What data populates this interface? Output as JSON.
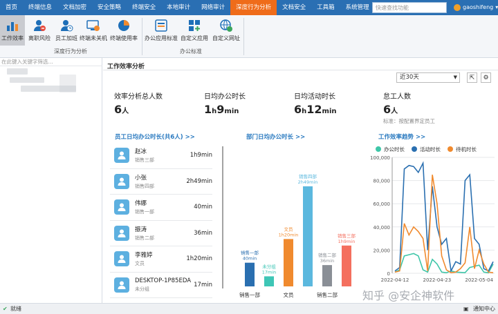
{
  "nav": {
    "tabs": [
      "首页",
      "终端信息",
      "文档加密",
      "安全策略",
      "终端安全",
      "本地审计",
      "网络审计",
      "深度行为分析",
      "文档安全",
      "工具箱",
      "系统管理"
    ],
    "active_index": 7,
    "search_placeholder": "快速查找功能",
    "user": "gaoshifeng"
  },
  "ribbon": {
    "buttons": [
      "工作效率",
      "离职风险",
      "员工加班",
      "终端未关机",
      "终端使用率",
      "办公应用标准",
      "自定义应用",
      "自定义网址"
    ],
    "groups": [
      "深度行为分析",
      "办公标准"
    ]
  },
  "left": {
    "filter_placeholder": "在此键入关键字筛选..."
  },
  "main": {
    "title": "工作效率分析",
    "period": "近30天",
    "stats": [
      {
        "label": "效率分析总人数",
        "value": "6",
        "unit": "人"
      },
      {
        "label": "日均办公时长",
        "value_h": "1",
        "value_m": "9",
        "unit_h": "h",
        "unit_m": "min"
      },
      {
        "label": "日均活动时长",
        "value_h": "6",
        "value_m": "12",
        "unit_h": "h",
        "unit_m": "min"
      },
      {
        "label": "怠工人数",
        "value": "6",
        "unit": "人",
        "note": "标准：按配置界定员工"
      }
    ],
    "sections": [
      "员工日均办公时长(共6人) >>",
      "部门日均办公时长 >>",
      "工作效率趋势 >>"
    ]
  },
  "employees": [
    {
      "name": "赵冰",
      "dept": "销售三部",
      "time": "1h9min"
    },
    {
      "name": "小张",
      "dept": "销售四部",
      "time": "2h49min"
    },
    {
      "name": "伟娜",
      "dept": "销售一部",
      "time": "40min"
    },
    {
      "name": "振涛",
      "dept": "销售二部",
      "time": "36min"
    },
    {
      "name": "李雅婷",
      "dept": "文员",
      "time": "1h20min"
    },
    {
      "name": "DESKTOP-1P85EDA",
      "dept": "未分组",
      "time": "17min"
    }
  ],
  "chart_data": [
    {
      "type": "bar",
      "title": "部门日均办公时长",
      "categories": [
        "销售一部",
        "未分组",
        "文员",
        "销售四部",
        "销售二部",
        "销售三部"
      ],
      "values": [
        40,
        17,
        80,
        169,
        36,
        69
      ],
      "value_labels": [
        "40min",
        "17min",
        "1h20min",
        "2h49min",
        "36min",
        "1h9min"
      ],
      "x_tick_labels": [
        "销售一部",
        "文员",
        "销售二部"
      ],
      "colors": [
        "#2a6fb0",
        "#3ec6b6",
        "#f08a2e",
        "#5bb8de",
        "#8a8f96",
        "#f46f5e"
      ]
    },
    {
      "type": "line",
      "title": "工作效率趋势",
      "ylim": [
        0,
        100000
      ],
      "y_ticks": [
        0,
        20000,
        40000,
        60000,
        80000,
        100000
      ],
      "x_tick_labels": [
        "2022-04-12",
        "2022-04-23",
        "2022-05-04"
      ],
      "series": [
        {
          "name": "办公时长",
          "color": "#3ec6a8",
          "values": [
            1000,
            3000,
            15000,
            16000,
            17000,
            15000,
            3000,
            1000,
            12000,
            8000,
            1000,
            500,
            2000,
            1000,
            800,
            600,
            5000,
            6000,
            7000,
            1000,
            500,
            8000
          ]
        },
        {
          "name": "活动时长",
          "color": "#2a6fb0",
          "values": [
            2000,
            5000,
            90000,
            93000,
            92000,
            87000,
            95000,
            20000,
            75000,
            40000,
            25000,
            30000,
            2000,
            10000,
            8000,
            80000,
            85000,
            30000,
            25000,
            4000,
            2000,
            10000
          ]
        },
        {
          "name": "待机时长",
          "color": "#f08a2e",
          "values": [
            1000,
            2000,
            43000,
            33000,
            40000,
            36000,
            30000,
            2000,
            85000,
            60000,
            15000,
            3000,
            500,
            1000,
            4000,
            9000,
            40000,
            4000,
            20000,
            8000,
            1000,
            500
          ]
        }
      ]
    }
  ],
  "status": {
    "left": "就绪",
    "right": "通知中心"
  },
  "watermark": "知乎 @安企神软件"
}
